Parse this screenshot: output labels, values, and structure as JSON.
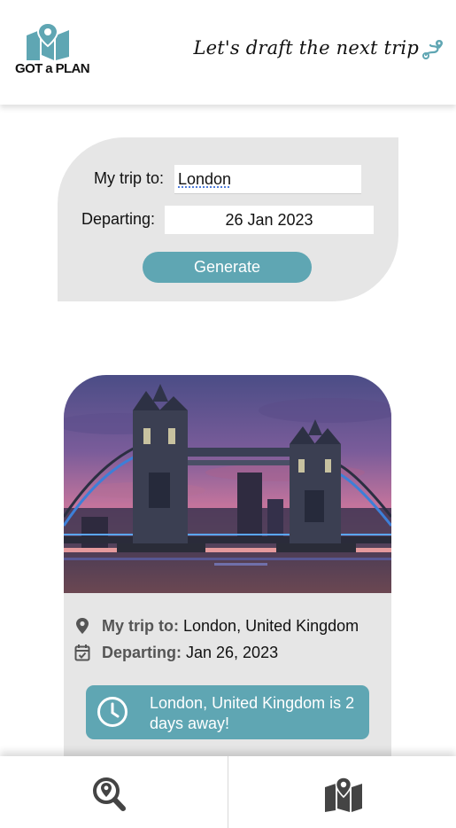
{
  "header": {
    "logo_text": "GOT a PLAN",
    "tagline": "Let's draft the next trip",
    "icons": [
      "map-pin-logo-icon",
      "route-icon"
    ]
  },
  "trip_form": {
    "destination_label": "My trip to:",
    "destination_value": "London",
    "departing_label": "Departing:",
    "departing_value": "26 Jan 2023",
    "generate_label": "Generate"
  },
  "result_card": {
    "image_alt": "Tower Bridge, London at sunset",
    "destination_label": "My trip to:",
    "destination_value": "London, United Kingdom",
    "departing_label": "Departing:",
    "departing_value": "Jan 26, 2023",
    "countdown_text": "London, United Kingdom is 2 days away!",
    "icons": [
      "location-pin-icon",
      "calendar-check-icon",
      "clock-icon"
    ]
  },
  "bottom_nav": {
    "items": [
      {
        "name": "search",
        "icon": "search-location-icon"
      },
      {
        "name": "map",
        "icon": "map-location-icon"
      }
    ]
  },
  "colors": {
    "accent": "#5fa6b3",
    "panel": "#e6e6e6",
    "icon_dark": "#444444"
  }
}
